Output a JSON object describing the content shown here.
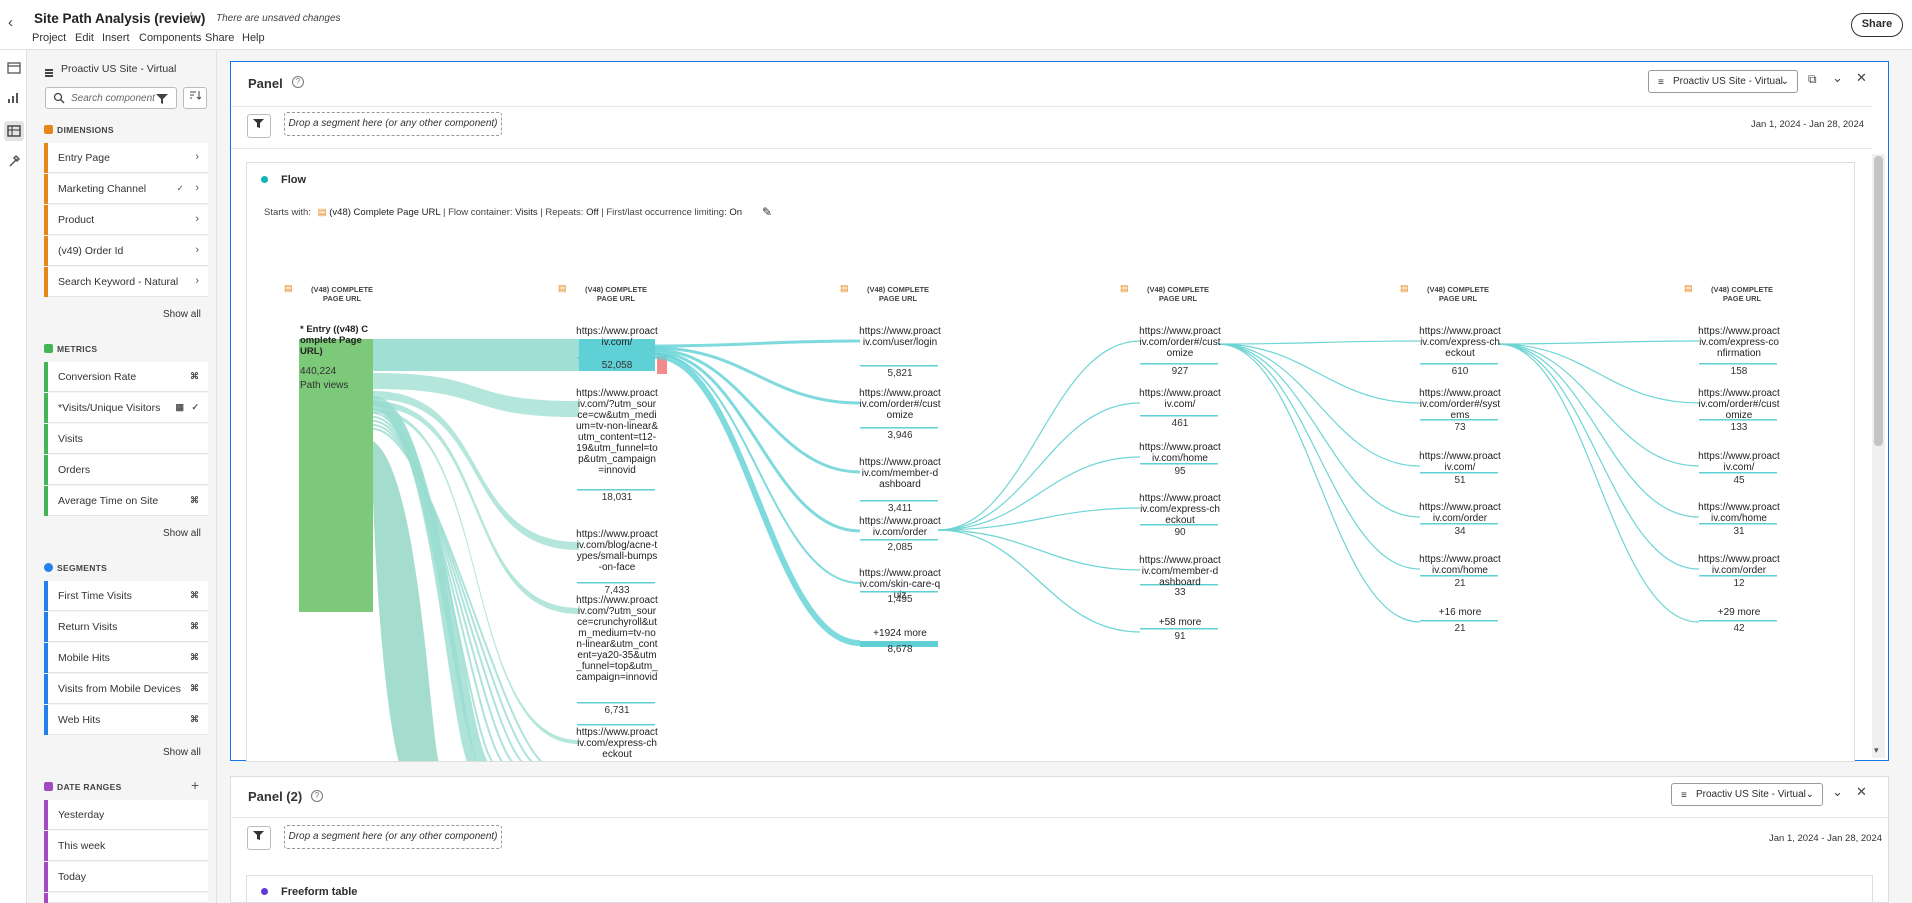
{
  "app": {
    "title": "Site Path Analysis (review)",
    "unsaved": "There are unsaved changes",
    "menu": [
      "Project",
      "Edit",
      "Insert",
      "Components",
      "Share",
      "Help"
    ],
    "share_label": "Share"
  },
  "components": {
    "report_suite": "Proactiv US Site - Virtual",
    "search_placeholder": "Search component",
    "dimensions_title": "DIMENSIONS",
    "dimensions": [
      "Entry Page",
      "Marketing Channel",
      "Product",
      "(v49) Order Id",
      "Search Keyword - Natural"
    ],
    "metrics_title": "METRICS",
    "metrics": [
      "Conversion Rate",
      "*Visits/Unique Visitors",
      "Visits",
      "Orders",
      "Average Time on Site"
    ],
    "segments_title": "SEGMENTS",
    "segments": [
      "First Time Visits",
      "Return Visits",
      "Mobile Hits",
      "Visits from Mobile Devices",
      "Web Hits"
    ],
    "dateranges_title": "DATE RANGES",
    "dateranges": [
      "Yesterday",
      "This week",
      "Today"
    ],
    "show_all": "Show all",
    "colors": {
      "dimension": "#e68619",
      "metric": "#44b556",
      "segment": "#2680eb",
      "daterange": "#a349c4"
    }
  },
  "panel1": {
    "title": "Panel",
    "report_suite": "Proactiv US Site - Virtual",
    "drop_zone": "Drop a segment here (or any other component)",
    "date_range": "Jan 1, 2024 - Jan 28, 2024",
    "viz_title": "Flow",
    "settings": {
      "starts_with_label": "Starts with:",
      "starts_with": "(v48) Complete Page URL",
      "container_label": "Flow container:",
      "container": "Visits",
      "repeats_label": "Repeats:",
      "repeats": "Off",
      "limiting_label": "First/last occurrence limiting:",
      "limiting": "On"
    },
    "column_header": "(V48) COMPLETE PAGE URL",
    "entry": {
      "label": "* Entry ((v48) Complete Page URL)",
      "value": "440,224",
      "unit": "Path views"
    },
    "columns": [
      {
        "nodes": [
          {
            "label": "https://www.proactiv.com/",
            "value": "52,058"
          },
          {
            "label": "https://www.proactiv.com/?utm_source=cw&utm_medium=tv-non-linear&utm_content=t12-19&utm_funnel=top&utm_campaign=innovid",
            "value": "18,031"
          },
          {
            "label": "https://www.proactiv.com/blog/acne-types/small-bumps-on-face",
            "value": "7,433"
          },
          {
            "label": "https://www.proactiv.com/?utm_source=crunchyroll&utm_medium=tv-non-linear&utm_content=ya20-35&utm_funnel=top&utm_campaign=innovid",
            "value": "6,731"
          },
          {
            "label": "https://www.proactiv.com/express-checkout",
            "value": ""
          }
        ]
      },
      {
        "nodes": [
          {
            "label": "https://www.proactiv.com/user/login",
            "value": "5,821"
          },
          {
            "label": "https://www.proactiv.com/order#/customize",
            "value": "3,946"
          },
          {
            "label": "https://www.proactiv.com/member-dashboard",
            "value": "3,411"
          },
          {
            "label": "https://www.proactiv.com/order",
            "value": "2,085"
          },
          {
            "label": "https://www.proactiv.com/skin-care-quiz",
            "value": "1,495"
          },
          {
            "label": "+1924 more",
            "value": "8,678"
          }
        ]
      },
      {
        "nodes": [
          {
            "label": "https://www.proactiv.com/order#/customize",
            "value": "927"
          },
          {
            "label": "https://www.proactiv.com/",
            "value": "461"
          },
          {
            "label": "https://www.proactiv.com/home",
            "value": "95"
          },
          {
            "label": "https://www.proactiv.com/express-checkout",
            "value": "90"
          },
          {
            "label": "https://www.proactiv.com/member-dashboard",
            "value": "33"
          },
          {
            "label": "+58 more",
            "value": "91"
          }
        ]
      },
      {
        "nodes": [
          {
            "label": "https://www.proactiv.com/express-checkout",
            "value": "610"
          },
          {
            "label": "https://www.proactiv.com/order#/systems",
            "value": "73"
          },
          {
            "label": "https://www.proactiv.com/",
            "value": "51"
          },
          {
            "label": "https://www.proactiv.com/order",
            "value": "34"
          },
          {
            "label": "https://www.proactiv.com/home",
            "value": "21"
          },
          {
            "label": "+16 more",
            "value": "21"
          }
        ]
      },
      {
        "nodes": [
          {
            "label": "https://www.proactiv.com/express-confirmation",
            "value": "158"
          },
          {
            "label": "https://www.proactiv.com/order#/customize",
            "value": "133"
          },
          {
            "label": "https://www.proactiv.com/",
            "value": "45"
          },
          {
            "label": "https://www.proactiv.com/home",
            "value": "31"
          },
          {
            "label": "https://www.proactiv.com/order",
            "value": "12"
          },
          {
            "label": "+29 more",
            "value": "42"
          }
        ]
      }
    ]
  },
  "panel2": {
    "title": "Panel (2)",
    "report_suite": "Proactiv US Site - Virtual",
    "drop_zone": "Drop a segment here (or any other component)",
    "date_range": "Jan 1, 2024 - Jan 28, 2024",
    "viz_title": "Freeform table"
  }
}
